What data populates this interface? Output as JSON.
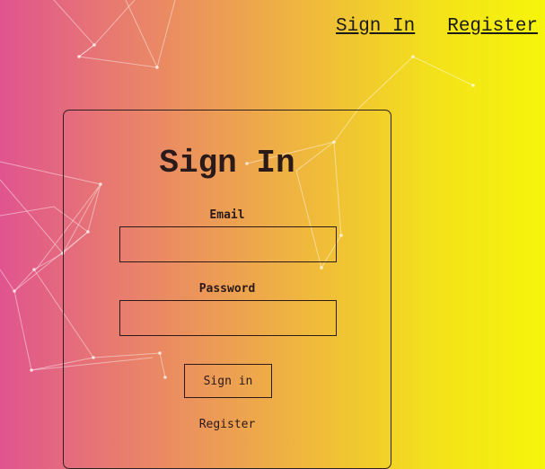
{
  "nav": {
    "sign_in": "Sign In",
    "register": "Register"
  },
  "form": {
    "title": "Sign In",
    "email_label": "Email",
    "email_value": "",
    "password_label": "Password",
    "password_value": "",
    "submit_label": "Sign in",
    "register_link": "Register"
  },
  "colors": {
    "gradient_left": "#e0548f",
    "gradient_right": "#f6f50a",
    "network_lines": "#ffffff"
  }
}
